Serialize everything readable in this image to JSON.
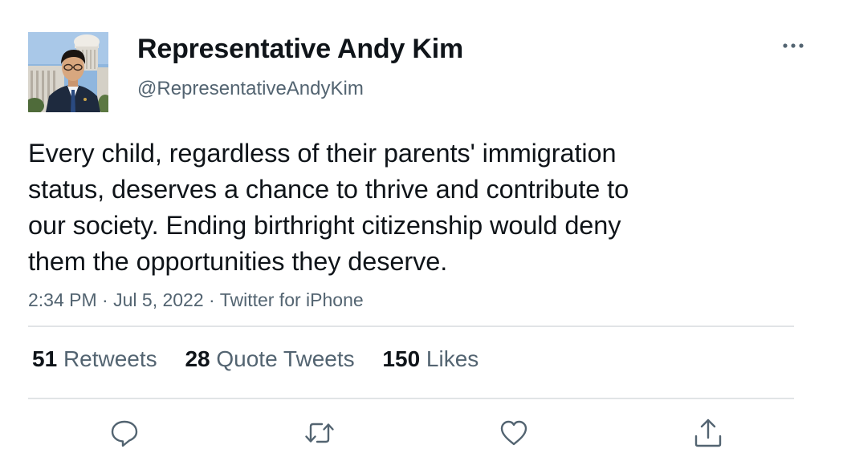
{
  "author": {
    "display_name": "Representative Andy Kim",
    "handle": "@RepresentativeAndyKim",
    "avatar": "profile-photo-capitol"
  },
  "tweet": {
    "lines": [
      "Every child, regardless of their parents' immigration",
      "status, deserves a chance to thrive and contribute to",
      "our society. Ending birthright citizenship would deny",
      "them the opportunities they deserve."
    ],
    "time": "2:34 PM",
    "separator": "·",
    "date": "Jul 5, 2022",
    "source": "Twitter for iPhone"
  },
  "stats": {
    "retweets": {
      "count": "51",
      "label": "Retweets"
    },
    "quotes": {
      "count": "28",
      "label": "Quote Tweets"
    },
    "likes": {
      "count": "150",
      "label": "Likes"
    }
  },
  "actions": [
    "reply-icon",
    "retweet-icon",
    "like-icon",
    "share-icon"
  ],
  "more_icon": "more-icon",
  "colors": {
    "text": "#0f1419",
    "secondary": "#536471",
    "divider": "#e1e4e6",
    "icon": "#536471"
  }
}
